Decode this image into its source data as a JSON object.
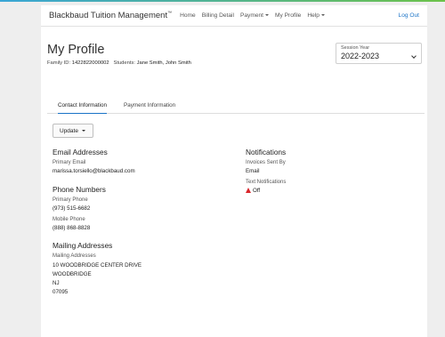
{
  "navbar": {
    "brand": "Blackbaud Tuition Management",
    "brand_mark": "™",
    "items": [
      {
        "label": "Home"
      },
      {
        "label": "Billing Detail"
      },
      {
        "label": "Payment"
      },
      {
        "label": "My Profile"
      },
      {
        "label": "Help"
      }
    ],
    "logout": "Log Out",
    "accent_color": "#1a73c7"
  },
  "header": {
    "title": "My Profile",
    "family_id_label": "Family ID:",
    "family_id": "1422822000002",
    "students_label": "Students:",
    "students": "Jane Smith, John Smith"
  },
  "session": {
    "label": "Session Year",
    "value": "2022-2023"
  },
  "tabs": [
    {
      "label": "Contact Information",
      "active": true
    },
    {
      "label": "Payment Information",
      "active": false
    }
  ],
  "update_button": "Update",
  "email": {
    "heading": "Email Addresses",
    "primary_label": "Primary Email",
    "primary_value": "marissa.torsiello@blackbaud.com"
  },
  "phones": {
    "heading": "Phone Numbers",
    "primary_label": "Primary Phone",
    "primary_value": "(973) 515-6682",
    "mobile_label": "Mobile Phone",
    "mobile_value": "(888) 868-8828"
  },
  "mailing": {
    "heading": "Mailing Addresses",
    "label": "Mailing Addresses",
    "line1": "10 WOODBRIDGE CENTER DRIVE",
    "city": "WOODBRIDGE",
    "state": "NJ",
    "zip": "07095"
  },
  "notifications": {
    "heading": "Notifications",
    "invoices_label": "Invoices Sent By",
    "invoices_value": "Email",
    "text_label": "Text Notifications",
    "text_value": "Off",
    "warn_icon": "warning-triangle-icon",
    "warn_color": "#d9262b"
  }
}
